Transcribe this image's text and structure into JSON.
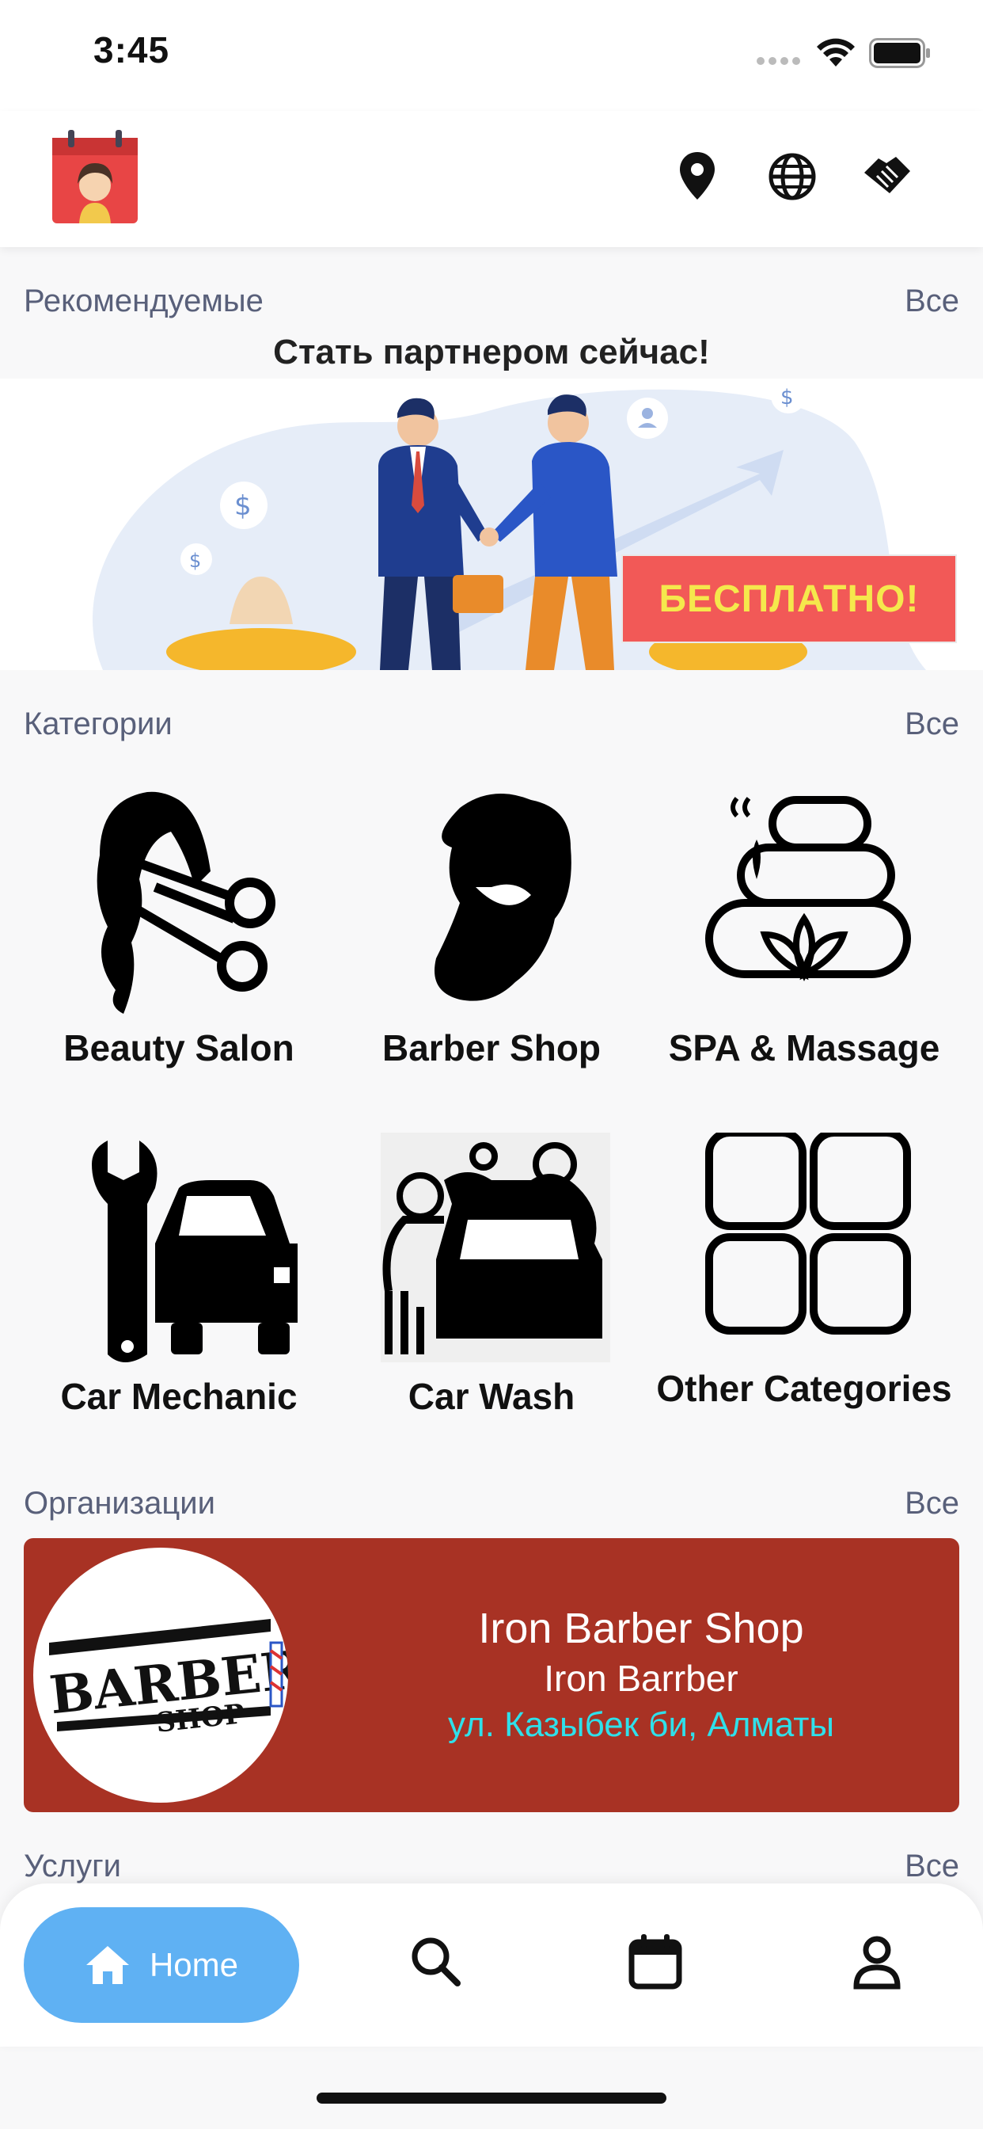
{
  "status_bar": {
    "time": "3:45"
  },
  "sections": {
    "recommended": {
      "title": "Рекомендуемые",
      "all": "Все"
    },
    "categories": {
      "title": "Категории",
      "all": "Все"
    },
    "organizations": {
      "title": "Организации",
      "all": "Все"
    },
    "services": {
      "title": "Услуги",
      "all": "Все"
    }
  },
  "promo": {
    "title": "Стать партнером сейчас!",
    "badge": "БЕСПЛАТНО!"
  },
  "categories": [
    {
      "label": "Beauty Salon",
      "icon": "beauty-salon-icon"
    },
    {
      "label": "Barber Shop",
      "icon": "barber-shop-icon"
    },
    {
      "label": "SPA & Massage",
      "icon": "spa-massage-icon"
    },
    {
      "label": "Car Mechanic",
      "icon": "car-mechanic-icon"
    },
    {
      "label": "Car Wash",
      "icon": "car-wash-icon"
    },
    {
      "label": "Other Categories",
      "icon": "other-categories-icon"
    }
  ],
  "organization": {
    "name": "Iron Barber Shop",
    "subtitle": "Iron Barrber",
    "address": "ул. Казыбек би, Алматы",
    "logo_text_1": "BARBER",
    "logo_text_2": "SHOP"
  },
  "bottom_nav": {
    "home": "Home",
    "active_color": "#5fb1f3"
  },
  "colors": {
    "org_card": "#a83224",
    "badge_bg": "#f25957",
    "badge_text": "#f5e84c",
    "address": "#2fe0ea"
  }
}
